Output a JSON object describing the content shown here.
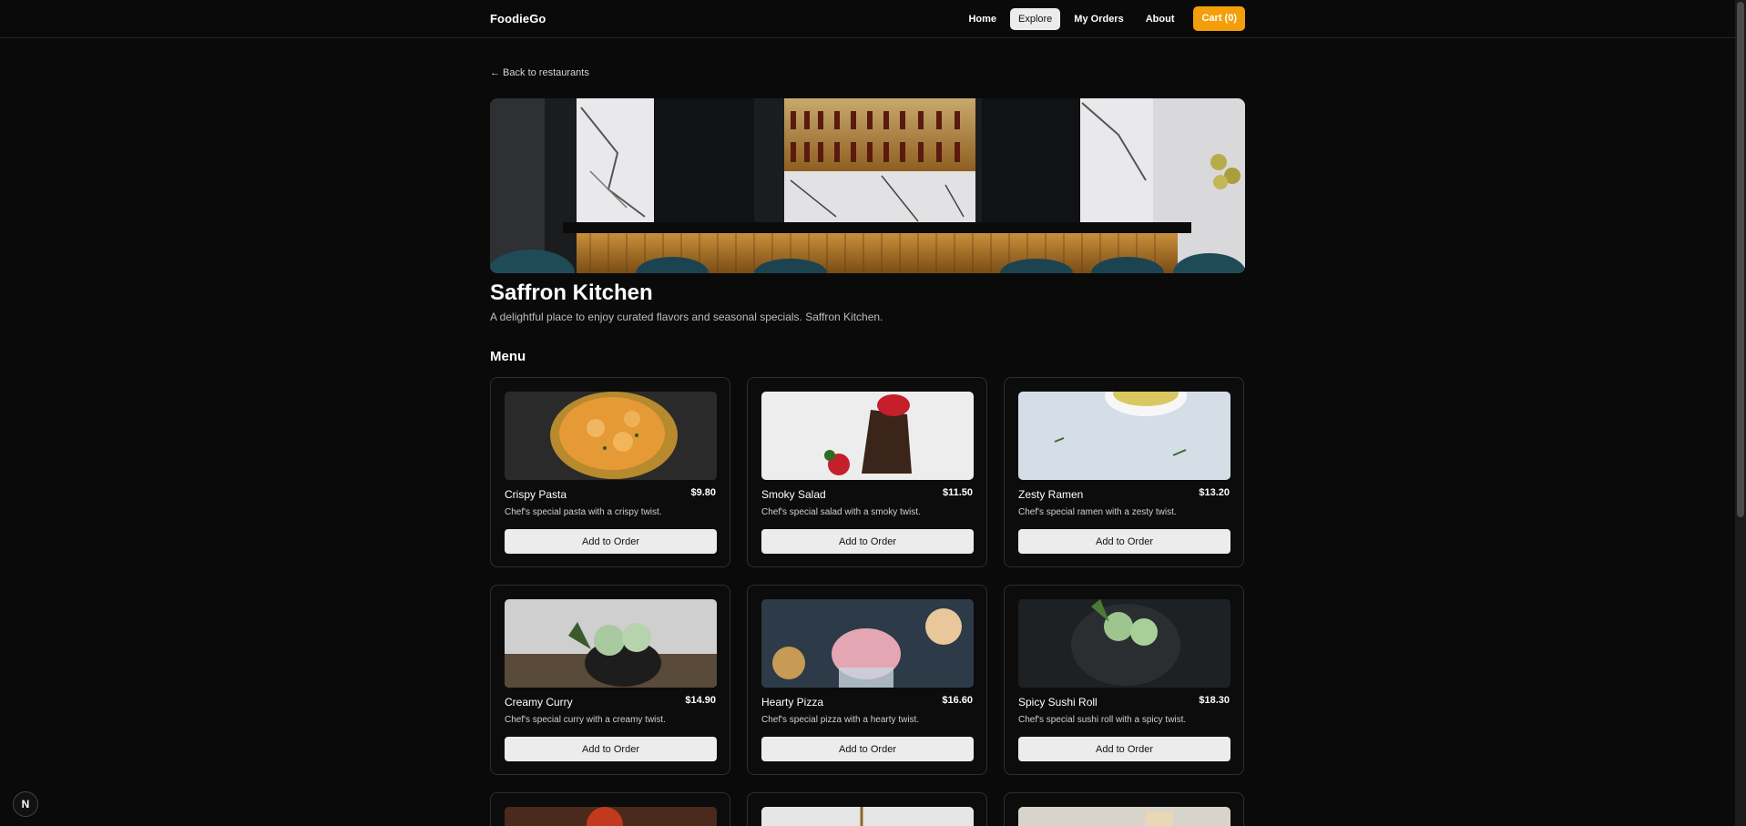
{
  "nav": {
    "brand": "FoodieGo",
    "links": [
      "Home",
      "Explore",
      "My Orders",
      "About"
    ],
    "active": "Explore",
    "cart_label": "Cart (0)",
    "accent": "#f59e0b"
  },
  "back_link": "← Back to restaurants",
  "restaurant": {
    "name": "Saffron Kitchen",
    "description": "A delightful place to enjoy curated flavors and seasonal specials. Saffron Kitchen."
  },
  "menu_heading": "Menu",
  "add_label": "Add to Order",
  "menu": [
    {
      "name": "Crispy Pasta",
      "price": "$9.80",
      "desc": "Chef's special pasta with a crispy twist.",
      "photo": "curry-bowl"
    },
    {
      "name": "Smoky Salad",
      "price": "$11.50",
      "desc": "Chef's special salad with a smoky twist.",
      "photo": "chocolate-cake"
    },
    {
      "name": "Zesty Ramen",
      "price": "$13.20",
      "desc": "Chef's special ramen with a zesty twist.",
      "photo": "bowl-on-plate"
    },
    {
      "name": "Creamy Curry",
      "price": "$14.90",
      "desc": "Chef's special curry with a creamy twist.",
      "photo": "mint-ice-cream"
    },
    {
      "name": "Hearty Pizza",
      "price": "$16.60",
      "desc": "Chef's special pizza with a hearty twist.",
      "photo": "pink-ice-cream"
    },
    {
      "name": "Spicy Sushi Roll",
      "price": "$18.30",
      "desc": "Chef's special sushi roll with a spicy twist.",
      "photo": "green-ice-cream"
    }
  ],
  "next_badge": "N"
}
